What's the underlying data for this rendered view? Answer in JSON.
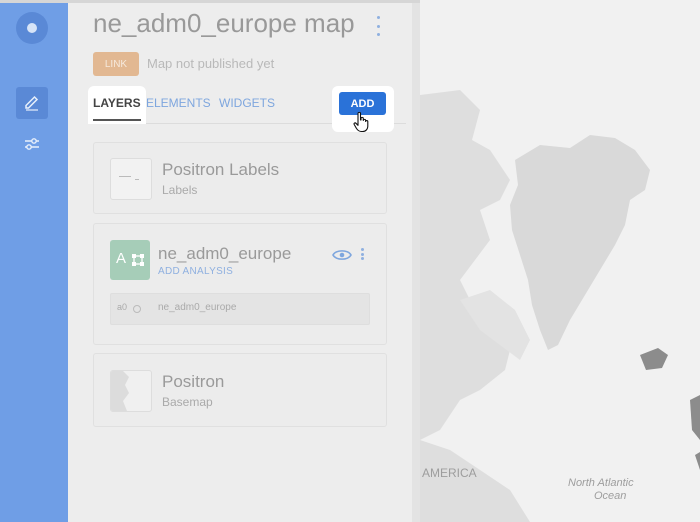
{
  "editor": {
    "title": "ne_adm0_europe map",
    "link_label": "LINK",
    "publish_status": "Map not published yet"
  },
  "tabs": [
    {
      "label": "LAYERS",
      "active": true
    },
    {
      "label": "ELEMENTS",
      "active": false
    },
    {
      "label": "WIDGETS",
      "active": false
    }
  ],
  "add_button": "ADD",
  "layers": [
    {
      "name": "Positron Labels",
      "subtitle": "Labels"
    },
    {
      "name": "ne_adm0_europe",
      "action": "ADD ANALYSIS",
      "thumb_letter": "A",
      "analysis": {
        "id": "a0",
        "source": "ne_adm0_europe"
      }
    },
    {
      "name": "Positron",
      "subtitle": "Basemap"
    }
  ],
  "map_labels": {
    "america": "AMERICA",
    "ocean_line1": "North Atlantic",
    "ocean_line2": "Ocean"
  },
  "colors": {
    "rail": "#6f9ee6",
    "accent": "#2a72d8",
    "link_badge": "#e2b892",
    "layer_thumb": "#a6cdb8"
  },
  "icons": [
    "logo-icon",
    "pencil-icon",
    "sliders-icon",
    "kebab-menu-icon",
    "eye-icon",
    "hand-cursor-icon"
  ]
}
